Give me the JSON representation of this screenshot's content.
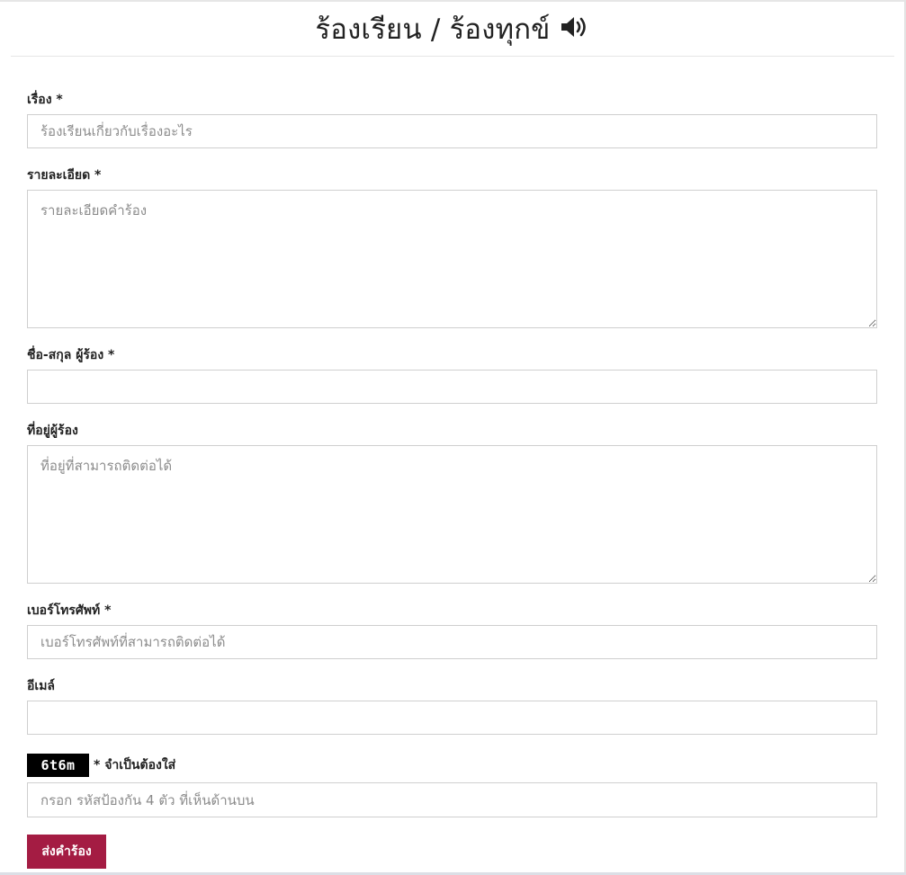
{
  "header": {
    "title": "ร้องเรียน / ร้องทุกข์",
    "icon": "speaker-icon"
  },
  "form": {
    "subject": {
      "label": "เรื่อง *",
      "placeholder": "ร้องเรียนเกี่ยวกับเรื่องอะไร",
      "value": ""
    },
    "details": {
      "label": "รายละเอียด *",
      "placeholder": "รายละเอียดคำร้อง",
      "value": ""
    },
    "name": {
      "label": "ชื่อ-สกุล ผู้ร้อง *",
      "placeholder": "",
      "value": ""
    },
    "address": {
      "label": "ที่อยู่ผู้ร้อง",
      "placeholder": "ที่อยู่ที่สามารถติดต่อได้",
      "value": ""
    },
    "phone": {
      "label": "เบอร์โทรศัพท์ *",
      "placeholder": "เบอร์โทรศัพท์ที่สามารถติดต่อได้",
      "value": ""
    },
    "email": {
      "label": "อีเมล์",
      "placeholder": "",
      "value": ""
    },
    "captcha": {
      "code": "6t6m",
      "note": "* จำเป็นต้องใส่",
      "placeholder": "กรอก รหัสป้องกัน 4 ตัว ที่เห็นด้านบน",
      "value": ""
    },
    "submit_label": "ส่งคำร้อง"
  },
  "colors": {
    "accent": "#a41c43",
    "border": "#cfcfcf",
    "captcha_bg": "#000000"
  }
}
